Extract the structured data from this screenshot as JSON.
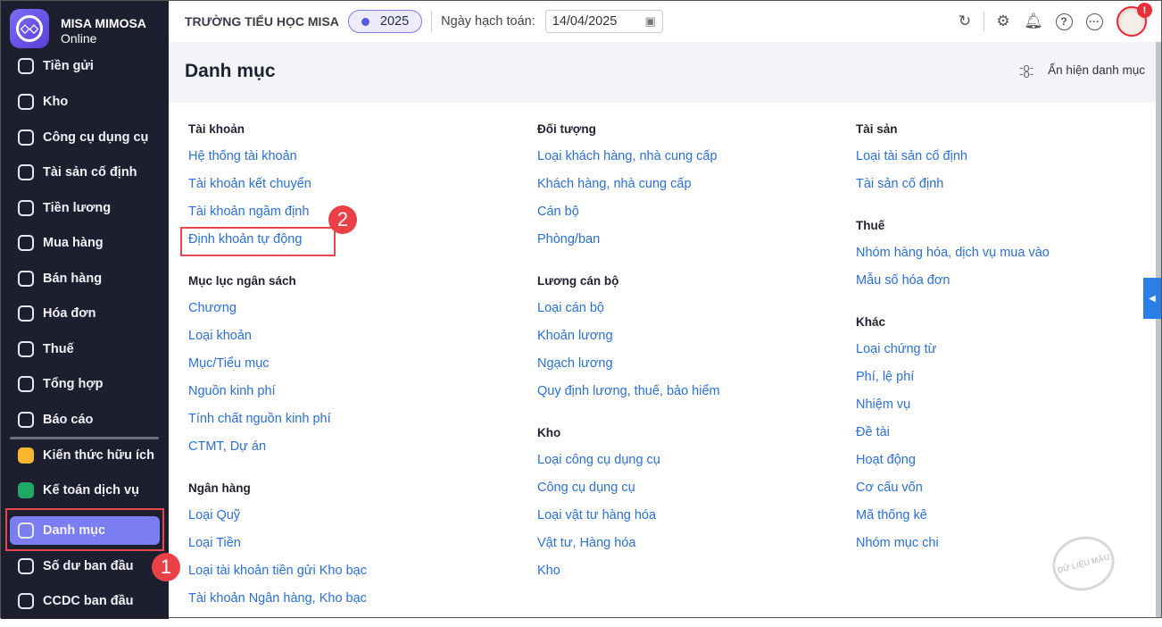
{
  "brand": {
    "name": "MISA MIMOSA",
    "sub": "Online"
  },
  "sidebar": {
    "items": [
      {
        "label": "Tiền gửi",
        "icon": "dollar-icon"
      },
      {
        "label": "Kho",
        "icon": "warehouse-icon"
      },
      {
        "label": "Công cụ dụng cụ",
        "icon": "tool-icon"
      },
      {
        "label": "Tài sản cố định",
        "icon": "truck-icon"
      },
      {
        "label": "Tiền lương",
        "icon": "salary-icon"
      },
      {
        "label": "Mua hàng",
        "icon": "cart-icon"
      },
      {
        "label": "Bán hàng",
        "icon": "store-icon"
      },
      {
        "label": "Hóa đơn",
        "icon": "invoice-icon"
      },
      {
        "label": "Thuế",
        "icon": "tax-icon"
      },
      {
        "label": "Tổng hợp",
        "icon": "summary-icon"
      },
      {
        "label": "Báo cáo",
        "icon": "report-icon"
      }
    ],
    "extra": [
      {
        "label": "Kiến thức hữu ích"
      },
      {
        "label": "Kế toán dịch vụ"
      },
      {
        "label": "Danh mục"
      },
      {
        "label": "Số dư ban đầu"
      },
      {
        "label": "CCDC ban đầu"
      }
    ]
  },
  "header": {
    "school": "TRƯỜNG TIỂU HỌC MISA",
    "year": "2025",
    "date_label": "Ngày hạch toán:",
    "date": "14/04/2025"
  },
  "page": {
    "title": "Danh mục",
    "toggle": "Ẩn hiện danh mục"
  },
  "columns": [
    [
      {
        "title": "Tài khoản",
        "items": [
          "Hệ thống tài khoản",
          "Tài khoản kết chuyển",
          "Tài khoản ngầm định",
          "Định khoản tự động"
        ]
      },
      {
        "title": "Mục lục ngân sách",
        "items": [
          "Chương",
          "Loại khoản",
          "Mục/Tiểu mục",
          "Nguồn kinh phí",
          "Tính chất nguồn kinh phí",
          "CTMT, Dự án"
        ]
      },
      {
        "title": "Ngân hàng",
        "items": [
          "Loại Quỹ",
          "Loại Tiền",
          "Loại tài khoản tiền gửi Kho bạc",
          "Tài khoản Ngân hàng, Kho bạc"
        ]
      }
    ],
    [
      {
        "title": "Đối tượng",
        "items": [
          "Loại khách hàng, nhà cung cấp",
          "Khách hàng, nhà cung cấp",
          "Cán bộ",
          "Phòng/ban"
        ]
      },
      {
        "title": "Lương cán bộ",
        "items": [
          "Loại cán bộ",
          "Khoản lương",
          "Ngạch lương",
          "Quy định lương, thuế, bảo hiểm"
        ]
      },
      {
        "title": "Kho",
        "items": [
          "Loại công cụ dụng cụ",
          "Công cụ dụng cụ",
          "Loại vật tư hàng hóa",
          "Vật tư, Hàng hóa",
          "Kho"
        ]
      }
    ],
    [
      {
        "title": "Tài sản",
        "items": [
          "Loại tài sản cố định",
          "Tài sản cố định"
        ]
      },
      {
        "title": "Thuế",
        "items": [
          "Nhóm hàng hóa, dịch vụ mua vào",
          "Mẫu số hóa đơn"
        ]
      },
      {
        "title": "Khác",
        "items": [
          "Loại chứng từ",
          "Phí, lệ phí",
          "Nhiệm vụ",
          "Đề tài",
          "Hoạt động",
          "Cơ cấu vốn",
          "Mã thống kê",
          "Nhóm mục chi"
        ]
      }
    ]
  ],
  "annotations": {
    "step1": "1",
    "step2": "2"
  },
  "stamp": "DỮ LIỆU MẪU",
  "colors": {
    "accent": "#7b7ef0",
    "link": "#2b6fd6",
    "sidebar": "#1d1f2e",
    "highlight": "#e8464e"
  }
}
